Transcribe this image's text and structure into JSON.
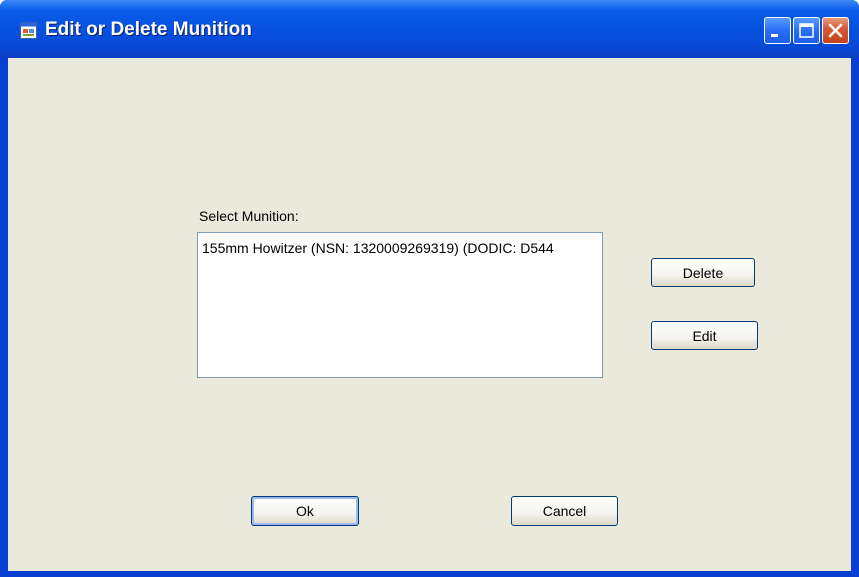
{
  "window": {
    "title": "Edit or Delete Munition",
    "controls": {
      "minimize_icon": "minimize-icon",
      "maximize_icon": "maximize-icon",
      "close_icon": "close-icon"
    }
  },
  "form": {
    "select_label": "Select Munition:",
    "munitions": [
      "155mm Howitzer (NSN: 1320009269319) (DODIC: D544"
    ],
    "delete_label": "Delete",
    "edit_label": "Edit",
    "ok_label": "Ok",
    "cancel_label": "Cancel"
  },
  "colors": {
    "titlebar": "#0651e0",
    "client_background": "#ebe9db",
    "close_button": "#d6562f"
  }
}
